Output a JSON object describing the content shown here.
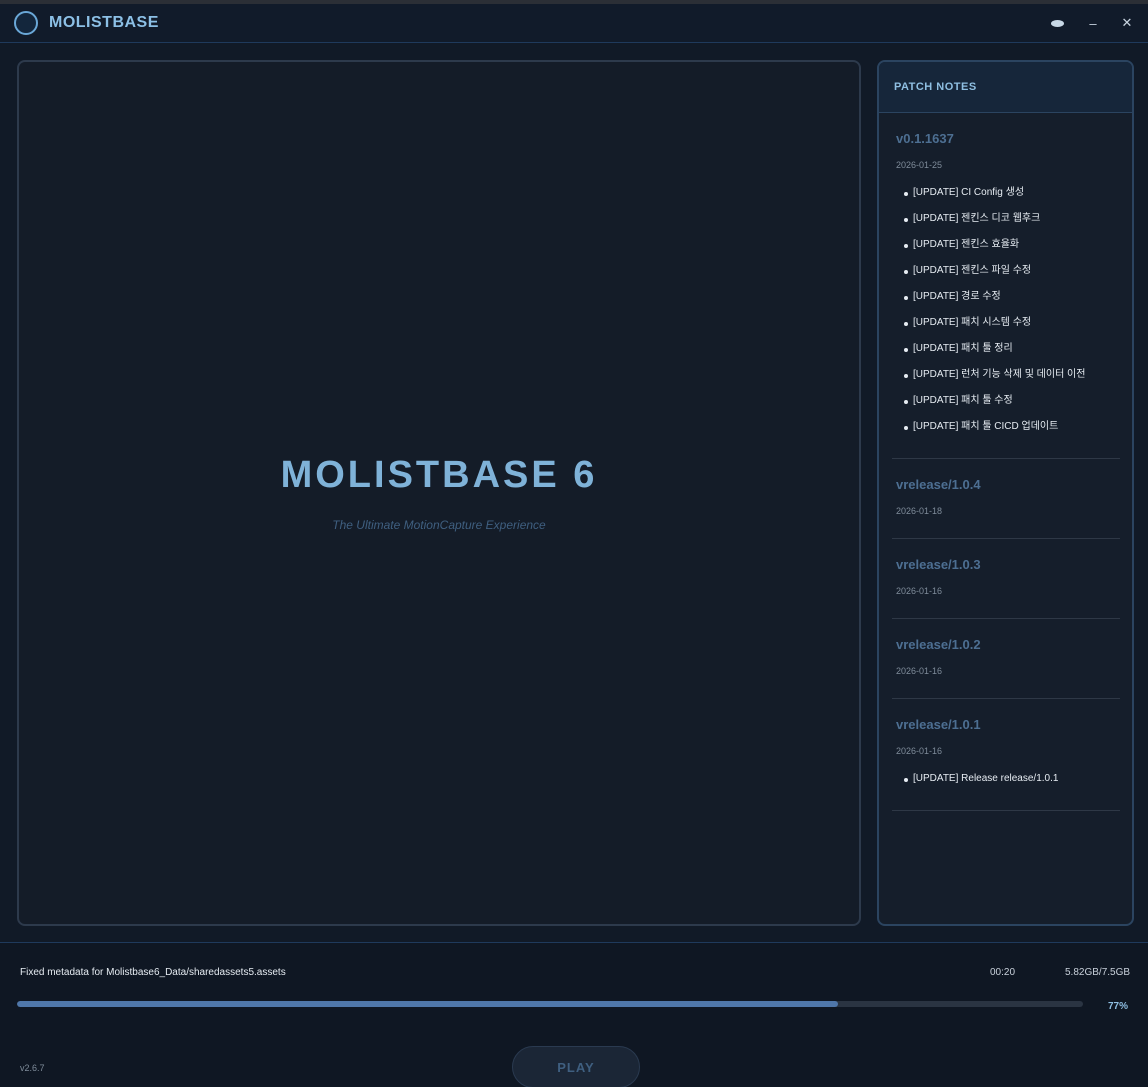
{
  "app": {
    "title": "MOLISTBASE"
  },
  "window_controls": {
    "minimize_glyph": "–",
    "close_glyph": "✕"
  },
  "hero": {
    "title": "MOLISTBASE 6",
    "subtitle": "The Ultimate MotionCapture Experience"
  },
  "patch_notes": {
    "header": "PATCH NOTES",
    "releases": [
      {
        "version": "v0.1.1637",
        "date": "2026-01-25",
        "items": [
          "[UPDATE] CI Config 생성",
          "[UPDATE] 젠킨스 디코 웹후크",
          "[UPDATE] 젠킨스 효율화",
          "[UPDATE] 젠킨스 파일 수정",
          "[UPDATE] 경로 수정",
          "[UPDATE] 패치 시스템 수정",
          "[UPDATE] 패치 툴 정리",
          "[UPDATE] 런처 기능 삭제 및 데이터 이전",
          "[UPDATE] 패치 툴 수정",
          "[UPDATE] 패치 툴 CICD 업데이트"
        ]
      },
      {
        "version": "vrelease/1.0.4",
        "date": "2026-01-18",
        "items": []
      },
      {
        "version": "vrelease/1.0.3",
        "date": "2026-01-16",
        "items": []
      },
      {
        "version": "vrelease/1.0.2",
        "date": "2026-01-16",
        "items": []
      },
      {
        "version": "vrelease/1.0.1",
        "date": "2026-01-16",
        "items": [
          "[UPDATE] Release release/1.0.1"
        ]
      }
    ]
  },
  "status": {
    "message": "Fixed metadata for Molistbase6_Data/sharedassets5.assets",
    "time": "00:20",
    "size": "5.82GB/7.5GB",
    "percent_label": "77%",
    "progress": 0.77
  },
  "footer": {
    "version": "v2.6.7",
    "play_label": "PLAY"
  },
  "colors": {
    "accent": "#8cc0e6",
    "progress_fill": "#4f77aa",
    "background": "#111a27"
  }
}
